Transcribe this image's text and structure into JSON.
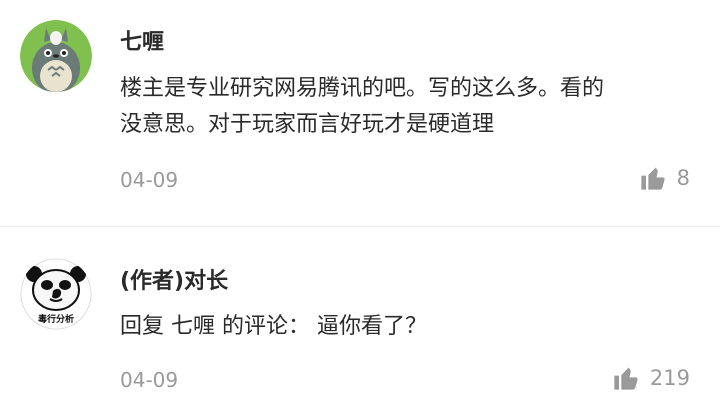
{
  "comments": [
    {
      "username": "七喱",
      "text_line1": "楼主是专业研究网易腾讯的吧。写的这么多。看的",
      "text_line2": "没意思。对于玩家而言好玩才是硬道理",
      "date": "04-09",
      "likes": "8",
      "avatar_icon": "totoro-avatar-icon",
      "like_icon": "thumbs-up-icon"
    },
    {
      "username": "(作者)对长",
      "reply_prefix": "回复",
      "reply_to": "七喱",
      "reply_suffix": "的评论：",
      "text": "逼你看了？",
      "date": "04-09",
      "likes": "219",
      "avatar_caption": "毒行分析",
      "avatar_icon": "panda-meme-avatar-icon",
      "like_icon": "thumbs-up-icon"
    }
  ],
  "colors": {
    "text": "#2a2a2a",
    "muted": "#9a9a9a",
    "avatar_green": "#7fc04f"
  }
}
